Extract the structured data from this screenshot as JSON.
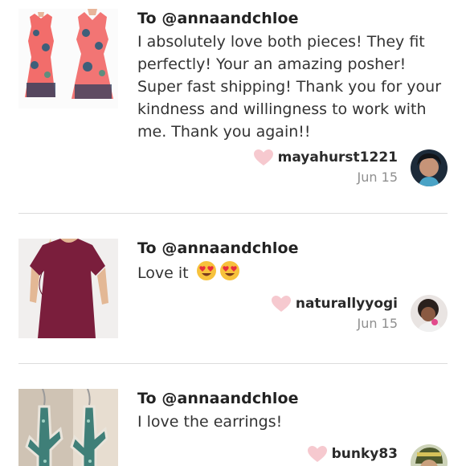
{
  "reviews": [
    {
      "to": "To @annaandchloe",
      "message": "I absolutely love both pieces! They fit perfectly! Your an amazing posher! Super fast shipping! Thank you for your kindness and willingness to work with me. Thank you again!!",
      "username": "mayahurst1221",
      "date": "Jun 15",
      "thumbnail_icon": "floral-dress-photo",
      "avatar_icon": "user-avatar-photo"
    },
    {
      "to": "To @annaandchloe",
      "message": "Love it",
      "emojis": [
        "heart-eyes-emoji",
        "heart-eyes-emoji"
      ],
      "username": "naturallyyogi",
      "date": "Jun 15",
      "thumbnail_icon": "burgundy-dress-photo",
      "avatar_icon": "user-avatar-photo"
    },
    {
      "to": "To @annaandchloe",
      "message": "I love the earrings!",
      "username": "bunky83",
      "date": "",
      "thumbnail_icon": "cactus-earrings-photo",
      "avatar_icon": "user-avatar-photo"
    }
  ],
  "colors": {
    "heart": "#f6c9cf",
    "divider": "#dcdcdc",
    "date_text": "#8f8f8f"
  }
}
